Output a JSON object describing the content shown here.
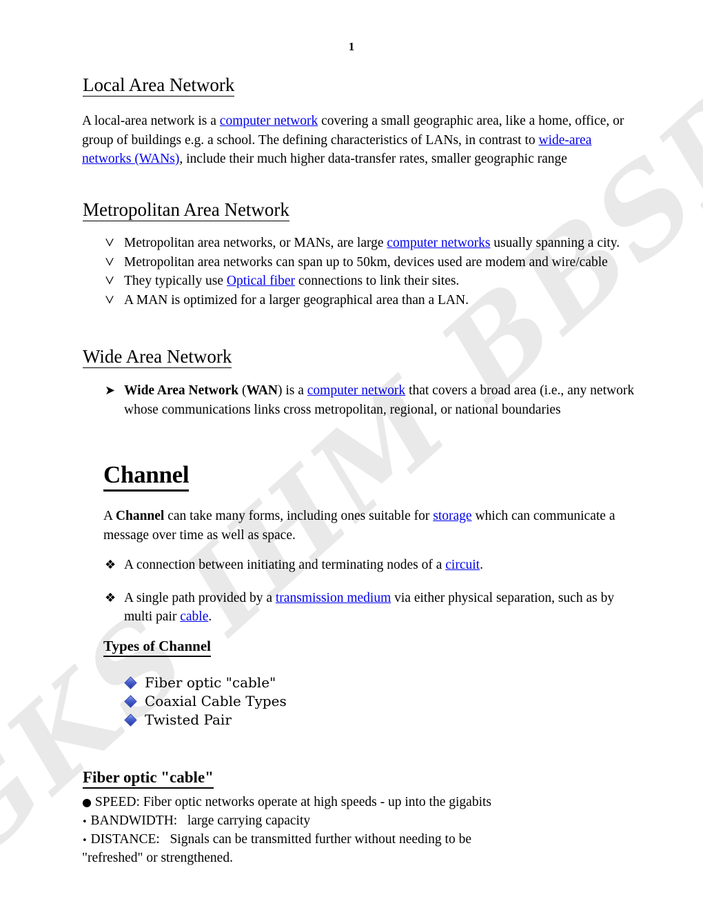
{
  "page": {
    "number": "1",
    "watermark": "GKS IHM BBSR",
    "link_color": "#0000ee",
    "bullet_diamond_color": "#3b54c4",
    "watermark_color": "#e9e9e9"
  },
  "sections": {
    "lan": {
      "heading": "Local Area Network",
      "paragraph": {
        "p1": "A local-area network is a ",
        "link1": "computer network",
        "p2": " covering a small geographic area, like a home, office, or group of buildings e.g. a school. The defining characteristics of LANs, in contrast to ",
        "link2": "wide-area networks (WANs)",
        "p3": ", include their much higher data-transfer rates, smaller geographic range"
      }
    },
    "man": {
      "heading": "Metropolitan Area Network",
      "bullet_glyph": "wingding-down-arrow",
      "items": [
        {
          "pre": "Metropolitan area networks, or MANs, are large ",
          "link": "computer networks",
          "post": " usually spanning a city."
        },
        {
          "pre": "Metropolitan area networks can span up to 50km, devices used are modem and wire/cable",
          "link": "",
          "post": ""
        },
        {
          "pre": "They typically use ",
          "link": "Optical fiber",
          "post": " connections to link their sites."
        },
        {
          "pre": "A MAN is optimized for a larger geographical area than a LAN.",
          "link": "",
          "post": ""
        }
      ]
    },
    "wan": {
      "heading": "Wide Area Network",
      "bullet_glyph": "arrowhead-right",
      "item": {
        "bold1": "Wide Area Network",
        "mid1": " (",
        "bold2": "WAN",
        "mid2": ") is a ",
        "link": "computer network",
        "post": " that covers a broad area (i.e., any network whose communications links cross metropolitan, regional, or national boundaries"
      }
    },
    "channel": {
      "heading": "Channel",
      "paragraph": {
        "p1": "A ",
        "bold": "Channel",
        "p2": " can take many forms, including ones suitable for ",
        "link": "storage",
        "p3": " which can communicate a message over time as well as space."
      },
      "bullet_glyph": "flower-diamond",
      "items": [
        {
          "pre": "A connection between initiating and terminating nodes of a ",
          "link": "circuit",
          "post": "."
        },
        {
          "pre": "A single path provided by a ",
          "link": "transmission medium",
          "mid": " via either physical separation, such as by multi pair ",
          "link2": "cable",
          "post": "."
        }
      ],
      "types": {
        "heading": "Types of Channel",
        "items": [
          "Fiber optic \"cable\"",
          "Coaxial Cable Types",
          "Twisted Pair"
        ]
      }
    },
    "fiber": {
      "heading": "Fiber optic \"cable\"",
      "lines": [
        {
          "marker": "●",
          "text": "SPEED: Fiber optic networks operate at high speeds - up into the gigabits"
        },
        {
          "marker": "•",
          "text": "BANDWIDTH:   large carrying capacity"
        },
        {
          "marker": "•",
          "text": "DISTANCE:   Signals can be transmitted further without needing to be"
        }
      ],
      "continuation": "\"refreshed\" or strengthened."
    }
  }
}
